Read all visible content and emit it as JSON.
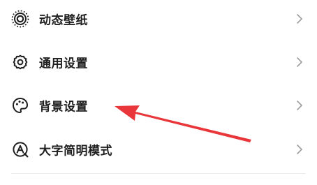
{
  "settings": {
    "items": [
      {
        "label": "动态壁纸",
        "icon": "live-wallpaper-icon"
      },
      {
        "label": "通用设置",
        "icon": "gear-icon"
      },
      {
        "label": "背景设置",
        "icon": "palette-icon"
      },
      {
        "label": "大字简明模式",
        "icon": "large-text-icon"
      }
    ]
  },
  "colors": {
    "text": "#1f1f1f",
    "chevron": "#9e9e9e",
    "arrow": "#e8363a"
  }
}
